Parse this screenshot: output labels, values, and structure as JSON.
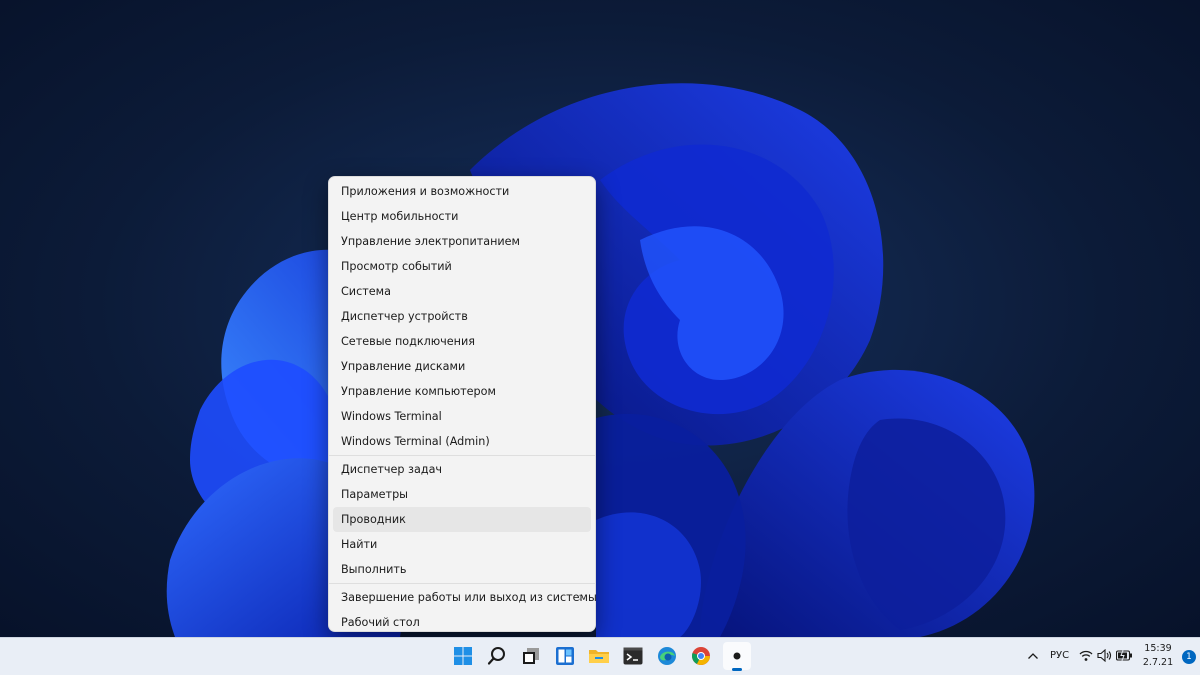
{
  "colors": {
    "wallpaper_bg": "#0b1a35",
    "bloom_primary": "#1a47ff",
    "menu_bg": "#f3f3f3",
    "taskbar_bg": "#e9eef6",
    "accent": "#0067c0"
  },
  "context_menu": {
    "groups": [
      [
        {
          "label": "Приложения и возможности"
        },
        {
          "label": "Центр мобильности"
        },
        {
          "label": "Управление электропитанием"
        },
        {
          "label": "Просмотр событий"
        },
        {
          "label": "Система"
        },
        {
          "label": "Диспетчер устройств"
        },
        {
          "label": "Сетевые подключения"
        },
        {
          "label": "Управление дисками"
        },
        {
          "label": "Управление компьютером"
        },
        {
          "label": "Windows Terminal"
        },
        {
          "label": "Windows Terminal (Admin)"
        }
      ],
      [
        {
          "label": "Диспетчер задач"
        },
        {
          "label": "Параметры"
        },
        {
          "label": "Проводник",
          "highlighted": true
        },
        {
          "label": "Найти"
        },
        {
          "label": "Выполнить"
        }
      ],
      [
        {
          "label": "Завершение работы или выход из системы",
          "submenu_icon": "chevron-right-icon"
        },
        {
          "label": "Рабочий стол"
        }
      ]
    ]
  },
  "taskbar": {
    "apps": [
      {
        "name": "start-icon"
      },
      {
        "name": "search-icon"
      },
      {
        "name": "task-view-icon"
      },
      {
        "name": "widgets-icon"
      },
      {
        "name": "file-explorer-icon"
      },
      {
        "name": "terminal-icon"
      },
      {
        "name": "edge-icon"
      },
      {
        "name": "chrome-icon"
      },
      {
        "name": "active-app-icon",
        "active": true
      }
    ],
    "tray": {
      "chevron_icon": "chevron-up-icon",
      "language": "РУС",
      "icons": [
        "wifi-icon",
        "volume-icon",
        "battery-icon"
      ],
      "time": "15:39",
      "date": "2.7.21",
      "notification_count": "1"
    }
  }
}
